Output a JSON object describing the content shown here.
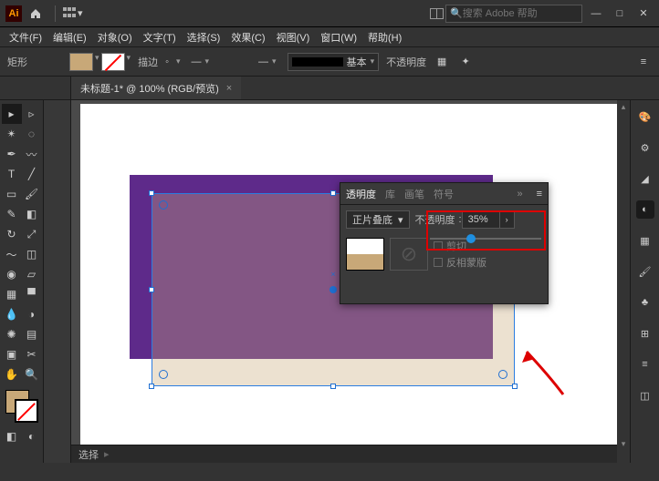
{
  "titlebar": {
    "search_placeholder": "搜索 Adobe 帮助"
  },
  "menus": {
    "file": "文件(F)",
    "edit": "编辑(E)",
    "object": "对象(O)",
    "type": "文字(T)",
    "select": "选择(S)",
    "effect": "效果(C)",
    "view": "视图(V)",
    "window": "窗口(W)",
    "help": "帮助(H)"
  },
  "control": {
    "shape": "矩形",
    "stroke_label": "描边",
    "basic": "基本",
    "opacity_label": "不透明度"
  },
  "tab": {
    "title": "未标题-1* @ 100% (RGB/预览)"
  },
  "zoom": {
    "value": "100%"
  },
  "status": {
    "mode": "选择"
  },
  "panel": {
    "tabs": {
      "transparency": "透明度",
      "lib": "库",
      "brush": "画笔",
      "symbol": "符号"
    },
    "blend_mode": "正片叠底",
    "opacity_label": "不透明度",
    "opacity_value": "35%",
    "clip": "剪切",
    "invert": "反相蒙版"
  },
  "colors": {
    "fill": "#C8A878",
    "purple": "#5e2a8a",
    "accent": "#1f6fd1"
  }
}
